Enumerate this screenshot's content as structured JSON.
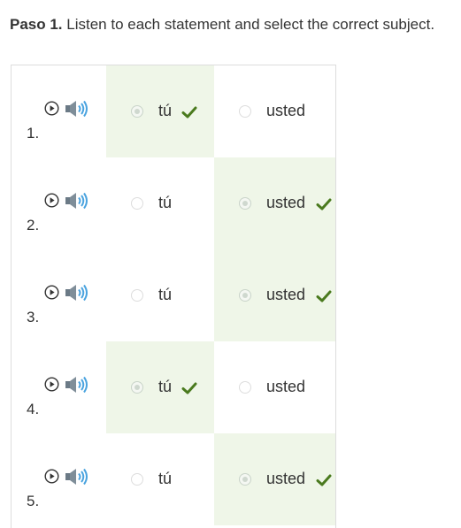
{
  "instruction": {
    "bold": "Paso 1.",
    "text": " Listen to each statement and select the correct subject."
  },
  "colors": {
    "correct_bg": "#eff6e8",
    "check": "#4a7a1e"
  },
  "items": [
    {
      "number": "1.",
      "options": [
        {
          "label": "tú",
          "selected": true,
          "correct": true
        },
        {
          "label": "usted",
          "selected": false,
          "correct": false
        }
      ]
    },
    {
      "number": "2.",
      "options": [
        {
          "label": "tú",
          "selected": false,
          "correct": false
        },
        {
          "label": "usted",
          "selected": true,
          "correct": true
        }
      ]
    },
    {
      "number": "3.",
      "options": [
        {
          "label": "tú",
          "selected": false,
          "correct": false
        },
        {
          "label": "usted",
          "selected": true,
          "correct": true
        }
      ]
    },
    {
      "number": "4.",
      "options": [
        {
          "label": "tú",
          "selected": true,
          "correct": true
        },
        {
          "label": "usted",
          "selected": false,
          "correct": false
        }
      ]
    },
    {
      "number": "5.",
      "options": [
        {
          "label": "tú",
          "selected": false,
          "correct": false
        },
        {
          "label": "usted",
          "selected": true,
          "correct": true
        }
      ]
    }
  ]
}
